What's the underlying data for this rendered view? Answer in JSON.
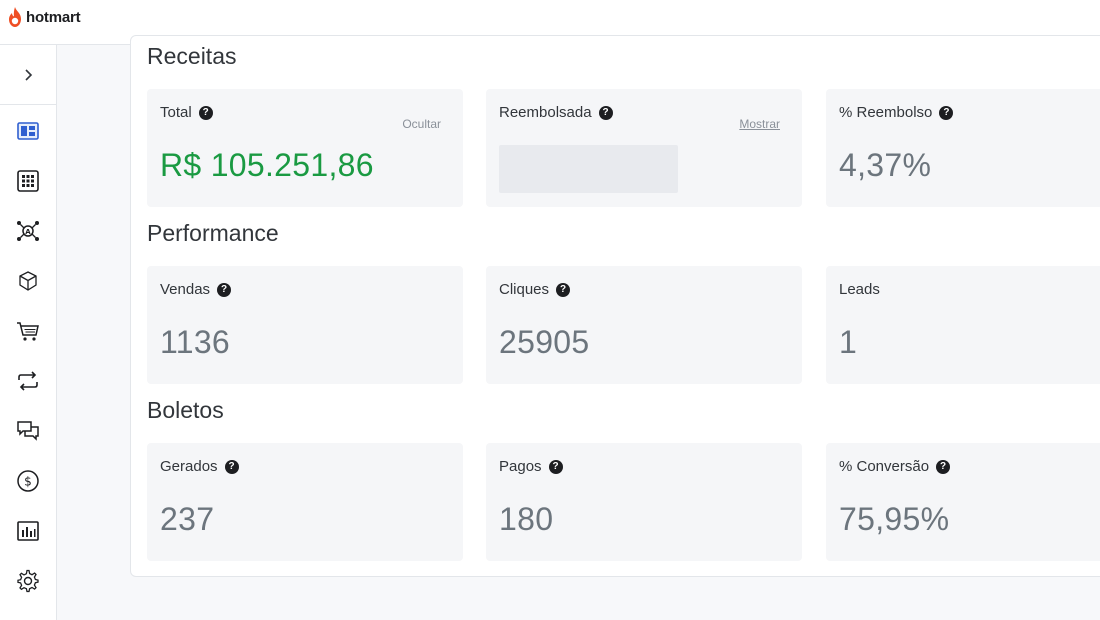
{
  "app": {
    "brand": "hotmart",
    "brand_color": "#ef4e23"
  },
  "sidebar": {
    "toggle_icon": "chevron-right-icon",
    "items": [
      {
        "name": "dashboard",
        "icon": "dashboard-icon"
      },
      {
        "name": "apps",
        "icon": "grid-icon"
      },
      {
        "name": "affiliates",
        "icon": "network-icon"
      },
      {
        "name": "products",
        "icon": "box-icon"
      },
      {
        "name": "sales",
        "icon": "cart-icon"
      },
      {
        "name": "subscriptions",
        "icon": "repeat-icon"
      },
      {
        "name": "messages",
        "icon": "chat-icon"
      },
      {
        "name": "finance",
        "icon": "dollar-icon"
      },
      {
        "name": "reports",
        "icon": "bar-chart-icon"
      },
      {
        "name": "settings",
        "icon": "gear-icon"
      }
    ]
  },
  "sections": {
    "receitas": {
      "title": "Receitas",
      "cards": {
        "total": {
          "label": "Total",
          "value": "R$ 105.251,86",
          "action": "Ocultar"
        },
        "reembolsada": {
          "label": "Reembolsada",
          "action": "Mostrar"
        },
        "reembolso_pct": {
          "label": "% Reembolso",
          "value": "4,37%"
        }
      }
    },
    "performance": {
      "title": "Performance",
      "cards": {
        "vendas": {
          "label": "Vendas",
          "value": "1136"
        },
        "cliques": {
          "label": "Cliques",
          "value": "25905"
        },
        "leads": {
          "label": "Leads",
          "value": "1"
        }
      }
    },
    "boletos": {
      "title": "Boletos",
      "cards": {
        "gerados": {
          "label": "Gerados",
          "value": "237"
        },
        "pagos": {
          "label": "Pagos",
          "value": "180"
        },
        "conversao": {
          "label": "% Conversão",
          "value": "75,95%"
        }
      }
    }
  },
  "colors": {
    "value_green": "#1a9a42",
    "value_gray": "#6c757d",
    "card_bg": "#f5f6f8"
  }
}
